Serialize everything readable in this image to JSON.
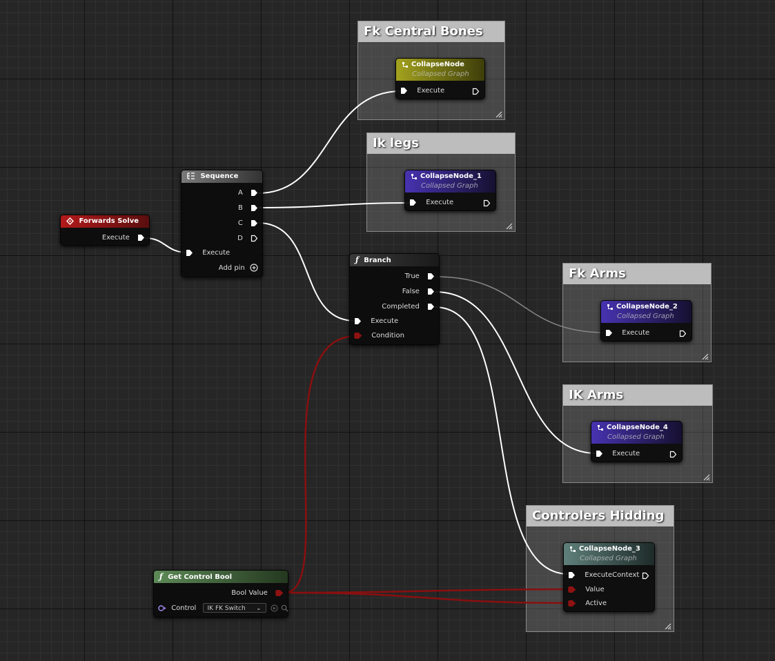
{
  "comments": [
    {
      "id": "fk-central",
      "title": "Fk Central Bones"
    },
    {
      "id": "ik-legs",
      "title": "Ik legs"
    },
    {
      "id": "fk-arms",
      "title": "Fk Arms"
    },
    {
      "id": "ik-arms",
      "title": "IK Arms"
    },
    {
      "id": "ctrl-hidding",
      "title": "Controlers Hidding"
    }
  ],
  "nodes": {
    "forwards_solve": {
      "title": "Forwards Solve",
      "out_pin": "Execute",
      "color": "#a31818"
    },
    "sequence": {
      "title": "Sequence",
      "pins": [
        "A",
        "B",
        "C",
        "D"
      ],
      "in_pin": "Execute",
      "add_pin": "Add pin"
    },
    "branch": {
      "title": "Branch",
      "outputs": [
        "True",
        "False",
        "Completed"
      ],
      "inputs": [
        "Execute",
        "Condition"
      ]
    },
    "get_control_bool": {
      "title": "Get Control Bool",
      "out_pin": "Bool Value",
      "control_label": "Control",
      "control_value": "IK FK Switch",
      "color": "#4f7a4a"
    },
    "collapse_0": {
      "title": "CollapseNode",
      "subtitle": "Collapsed Graph",
      "in_pin": "Execute",
      "color": "#8a8a1a"
    },
    "collapse_1": {
      "title": "CollapseNode_1",
      "subtitle": "Collapsed Graph",
      "in_pin": "Execute",
      "color": "#3b2a8a"
    },
    "collapse_2": {
      "title": "CollapseNode_2",
      "subtitle": "Collapsed Graph",
      "in_pin": "Execute",
      "color": "#3b2a8a"
    },
    "collapse_4": {
      "title": "CollapseNode_4",
      "subtitle": "Collapsed Graph",
      "in_pin": "Execute",
      "color": "#3b2a8a"
    },
    "collapse_3": {
      "title": "CollapseNode_3",
      "subtitle": "Collapsed Graph",
      "in_pins": [
        "ExecuteContext",
        "Value",
        "Active"
      ],
      "color": "#4a6a66"
    }
  },
  "colors": {
    "exec_wire": "#ffffff",
    "bool_wire": "#8a0f0f",
    "bool_pin": "#8e1212"
  }
}
